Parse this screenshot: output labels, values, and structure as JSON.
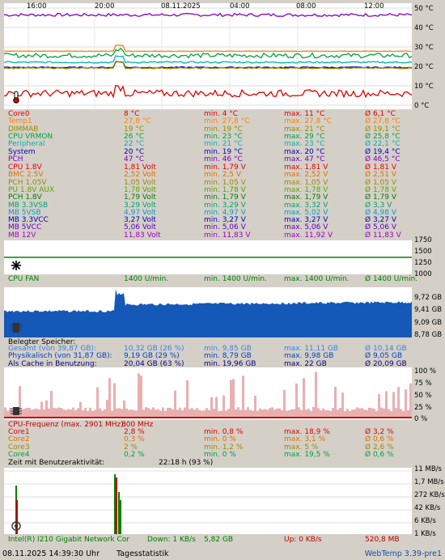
{
  "temp_chart": {
    "time_ticks": [
      "16:00",
      "20:00",
      "08.11.2025",
      "04:00",
      "08:00",
      "12:00"
    ],
    "y_labels": [
      "50 °C",
      "40 °C",
      "30 °C",
      "20 °C",
      "10 °C",
      "0 °C"
    ]
  },
  "temps": [
    {
      "name": "Core0",
      "value": "8 °C",
      "min": "min. 4 °C",
      "max": "max. 11 °C",
      "avg": "Ø 6,1 °C",
      "color": "#e00000"
    },
    {
      "name": "Temp1",
      "value": "27,8 °C",
      "min": "min. 27,8 °C",
      "max": "max. 27,8 °C",
      "avg": "Ø 27,8 °C",
      "color": "#ff8000"
    },
    {
      "name": "DIMMAB",
      "value": "19 °C",
      "min": "min. 19 °C",
      "max": "max. 21 °C",
      "avg": "Ø 19,1 °C",
      "color": "#9a8a00"
    },
    {
      "name": "CPU VRMON",
      "value": "26 °C",
      "min": "min. 23 °C",
      "max": "max. 29 °C",
      "avg": "Ø 25,8 °C",
      "color": "#00a040"
    },
    {
      "name": "Peripheral",
      "value": "22 °C",
      "min": "min. 21 °C",
      "max": "max. 23 °C",
      "avg": "Ø 22,1 °C",
      "color": "#00b0b0"
    },
    {
      "name": "System",
      "value": "20 °C",
      "min": "min. 19 °C",
      "max": "max. 20 °C",
      "avg": "Ø 19,4 °C",
      "color": "#0000c0"
    },
    {
      "name": "PCH",
      "value": "47 °C",
      "min": "min. 46 °C",
      "max": "max. 47 °C",
      "avg": "Ø 46,5 °C",
      "color": "#8000c0"
    }
  ],
  "volts": [
    {
      "name": "CPU 1.8V",
      "value": "1,81 Volt",
      "min": "min. 1,79 V",
      "max": "max. 1,81 V",
      "avg": "Ø 1,81 V",
      "color": "#e00000"
    },
    {
      "name": "BMC 2.5V",
      "value": "2,52 Volt",
      "min": "min. 2,5 V",
      "max": "max. 2,52 V",
      "avg": "Ø 2,51 V",
      "color": "#e07000"
    },
    {
      "name": "PCH 1.05V",
      "value": "1,05 Volt",
      "min": "min. 1,05 V",
      "max": "max. 1,05 V",
      "avg": "Ø 1,05 V",
      "color": "#9a8a00"
    },
    {
      "name": "PU 1.8V AUX",
      "value": "1,78 Volt",
      "min": "min. 1,78 V",
      "max": "max. 1,78 V",
      "avg": "Ø 1,78 V",
      "color": "#60a000"
    },
    {
      "name": "PCH 1.8V",
      "value": "1,79 Volt",
      "min": "min. 1,79 V",
      "max": "max. 1,79 V",
      "avg": "Ø 1,79 V",
      "color": "#008000"
    },
    {
      "name": "MB 3.3VSB",
      "value": "3,29 Volt",
      "min": "min. 3,29 V",
      "max": "max. 3,32 V",
      "avg": "Ø 3,3 V",
      "color": "#00a070"
    },
    {
      "name": "MB 5VSB",
      "value": "4,97 Volt",
      "min": "min. 4,97 V",
      "max": "max. 5,02 V",
      "avg": "Ø 4,98 V",
      "color": "#00a0c0"
    },
    {
      "name": "MB 3.3VCC",
      "value": "3,27 Volt",
      "min": "min. 3,27 V",
      "max": "max. 3,27 V",
      "avg": "Ø 3,27 V",
      "color": "#0000c0"
    },
    {
      "name": "MB 5VCC",
      "value": "5,06 Volt",
      "min": "min. 5,06 V",
      "max": "max. 5,06 V",
      "avg": "Ø 5,06 V",
      "color": "#6000c0"
    },
    {
      "name": "MB 12V",
      "value": "11,83 Volt",
      "min": "min. 11,83 V",
      "max": "max. 11,92 V",
      "avg": "Ø 11,83 V",
      "color": "#a000c0"
    }
  ],
  "fan_chart": {
    "y_labels": [
      "1750",
      "1500",
      "1250",
      "1000"
    ]
  },
  "fan": {
    "name": "CPU FAN",
    "value": "1400 U/min.",
    "min": "min. 1400 U/min.",
    "max": "max. 1400 U/min.",
    "avg": "Ø 1400 U/min.",
    "color": "#008000"
  },
  "mem_chart": {
    "y_labels": [
      "9,72 GB",
      "9,41 GB",
      "9,09 GB",
      "8,78 GB"
    ]
  },
  "mem_header": "Belegter Speicher:",
  "mem": [
    {
      "name": "Gesamt (von 39,87 GB):",
      "value": "10,32 GB (26 %)",
      "min": "min. 9,85 GB",
      "max": "max. 11,11 GB",
      "avg": "Ø 10,14 GB",
      "color": "#4080e0"
    },
    {
      "name": "Physikalisch (von 31,87 GB):",
      "value": "9,19 GB (29 %)",
      "min": "min. 8,79 GB",
      "max": "max. 9,98 GB",
      "avg": "Ø 9,05 GB",
      "color": "#0040c0"
    },
    {
      "name": "Als Cache in Benutzung:",
      "value": "20,04 GB (63 %)",
      "min": "min. 19,96 GB",
      "max": "max. 22 GB",
      "avg": "Ø 20,09 GB",
      "color": "#000080"
    }
  ],
  "cpu_chart": {
    "y_labels": [
      "100 %",
      "75 %",
      "50 %",
      "25 %",
      "0 %"
    ]
  },
  "cpu_freq": {
    "label": "CPU-Frequenz (max. 2901 MHz):",
    "value": "800 MHz"
  },
  "cpu": [
    {
      "name": "Core1",
      "value": "2,8 %",
      "min": "min. 0,8 %",
      "max": "max. 18,9 %",
      "avg": "Ø 3,2 %",
      "color": "#e00000"
    },
    {
      "name": "Core2",
      "value": "0,3 %",
      "min": "min. 0 %",
      "max": "max. 3,1 %",
      "avg": "Ø 0,6 %",
      "color": "#e07000"
    },
    {
      "name": "Core3",
      "value": "2 %",
      "min": "min. 1,2 %",
      "max": "max. 5 %",
      "avg": "Ø 2,6 %",
      "color": "#9a8a00"
    },
    {
      "name": "Core4",
      "value": "0,2 %",
      "min": "min. 0 %",
      "max": "max. 19,5 %",
      "avg": "Ø 0,6 %",
      "color": "#00a040"
    }
  ],
  "user_activity": {
    "label": "Zeit mit Benutzeraktivität:",
    "value": "22:18 h (93 %)"
  },
  "net_chart": {
    "y_labels": [
      "11 MB/s",
      "1,7 MB/s",
      "272 KB/s",
      "42 KB/s",
      "6 KB/s",
      "1 KB/s"
    ]
  },
  "net": {
    "name": "Intel(R) I210 Gigabit Network Cor",
    "down": "Down: 1 KB/s",
    "down_total": "5,82 GB",
    "up": "Up: 0 KB/s",
    "up_total": "520,8 MB"
  },
  "status": {
    "datetime": "08.11.2025 14:39:30 Uhr",
    "mode": "Tagesstatistik",
    "version": "WebTemp 3.39-pre1"
  }
}
